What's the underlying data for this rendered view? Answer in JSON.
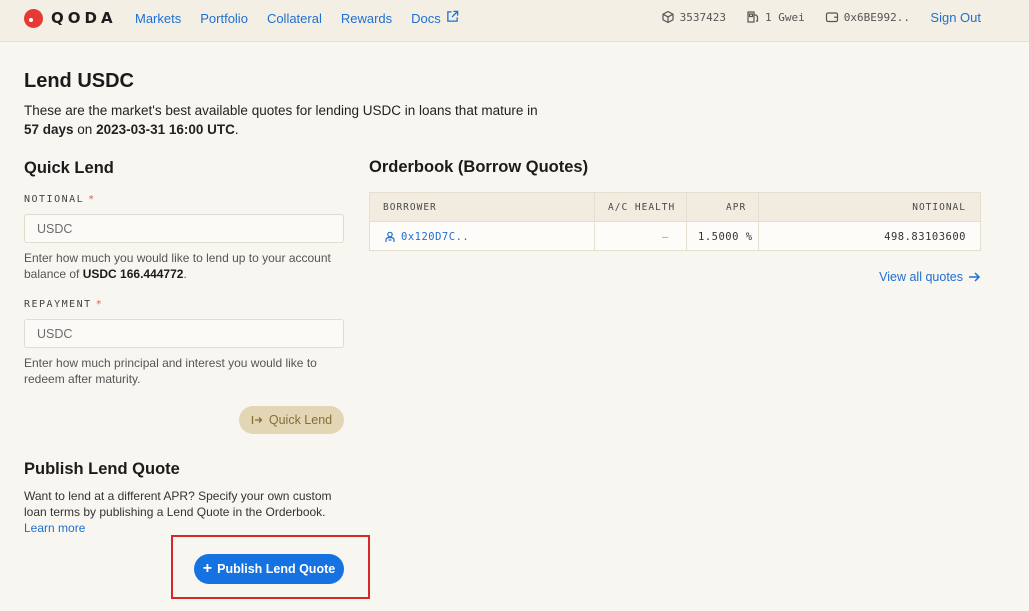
{
  "brand": {
    "name": "QODA",
    "accent": "#e53935"
  },
  "nav": {
    "links": [
      "Markets",
      "Portfolio",
      "Collateral",
      "Rewards",
      "Docs"
    ],
    "block": "3537423",
    "gas": "1 Gwei",
    "wallet": "0x6BE992..",
    "sign_out": "Sign Out"
  },
  "page": {
    "title": "Lend USDC",
    "lead_1": "These are the market's best available quotes for lending USDC in loans that mature in",
    "days": "57 days",
    "on": " on ",
    "date": "2023-03-31 16:00 UTC",
    "period": "."
  },
  "quick_lend": {
    "title": "Quick Lend",
    "notional_label": "NOTIONAL",
    "notional_placeholder": "USDC",
    "notional_help_1": "Enter how much you would like to lend up to your account balance of ",
    "notional_balance": "USDC 166.444772",
    "notional_help_end": ".",
    "repayment_label": "REPAYMENT",
    "repayment_placeholder": "USDC",
    "repayment_help": "Enter how much principal and interest you would like to redeem after maturity.",
    "button": "Quick Lend",
    "required_mark": "*"
  },
  "publish": {
    "title": "Publish Lend Quote",
    "desc": "Want to lend at a different APR? Specify your own custom loan terms by publishing a Lend Quote in the Orderbook.",
    "learn_more": "Learn more",
    "button": "Publish Lend Quote"
  },
  "orderbook": {
    "title": "Orderbook (Borrow Quotes)",
    "columns": [
      "BORROWER",
      "A/C HEALTH",
      "APR",
      "NOTIONAL"
    ],
    "rows": [
      {
        "borrower": "0x120D7C..",
        "health": "—",
        "apr": "1.5000",
        "apr_unit": "%",
        "notional": "498.83103600"
      }
    ],
    "view_all": "View all quotes"
  }
}
